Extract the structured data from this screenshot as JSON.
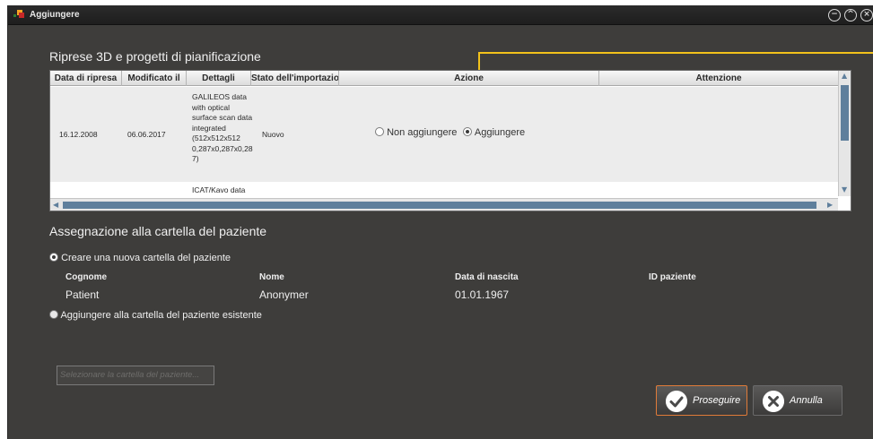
{
  "window": {
    "title": "Aggiungere",
    "logo_colors": [
      "#c62828",
      "#f5a623",
      "#2e7d32"
    ]
  },
  "window_controls": [
    "minimize-icon",
    "maximize-icon",
    "close-icon"
  ],
  "section1": {
    "title": "Riprese 3D e progetti di pianificazione"
  },
  "table": {
    "columns": [
      "Data di ripresa",
      "Modificato il",
      "Dettagli",
      "Stato dell'importazione",
      "Azione",
      "Attenzione"
    ],
    "rows": [
      {
        "date": "16.12.2008",
        "modified": "06.06.2017",
        "details_lines": [
          "GALILEOS data",
          "with optical",
          "surface scan data",
          "integrated",
          "(512x512x512",
          "0,287x0,287x0,28",
          "7)"
        ],
        "status": "Nuovo",
        "action_options": [
          "Non aggiungere",
          "Aggiungere"
        ],
        "action_selected": "Aggiungere"
      },
      {
        "date": "",
        "modified": "",
        "details_lines": [
          "ICAT/Kavo data"
        ],
        "status": "",
        "action_options": [],
        "action_selected": ""
      }
    ]
  },
  "callout_color": "#f2c21b",
  "section2": {
    "title": "Assegnazione alla cartella del paziente",
    "option_new": "Creare una nuova cartella del paziente",
    "option_existing": "Aggiungere alla cartella del paziente esistente",
    "selected": "new"
  },
  "patient": {
    "headers": {
      "surname": "Cognome",
      "name": "Nome",
      "birth": "Data di nascita",
      "id": "ID paziente"
    },
    "values": {
      "surname": "Patient",
      "name": "Anonymer",
      "birth": "01.01.1967",
      "id": ""
    }
  },
  "select_patient_placeholder": "Selezionare la cartella del paziente...",
  "buttons": {
    "continue": "Proseguire",
    "cancel": "Annulla"
  },
  "colors": {
    "accent": "#f2c21b",
    "continue_border": "#e07b39",
    "scroll": "#5f7f9c"
  }
}
